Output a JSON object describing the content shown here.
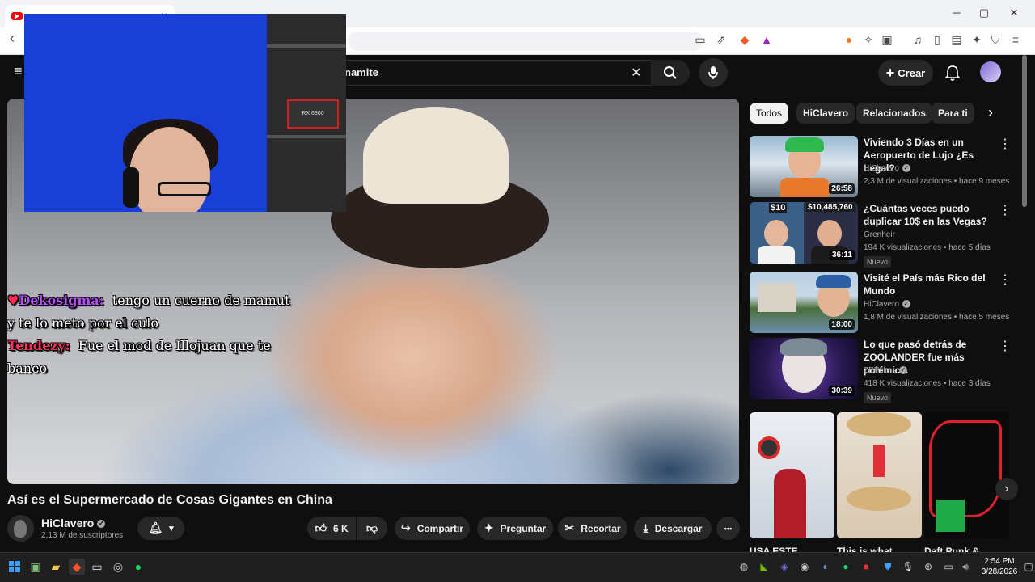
{
  "browser": {
    "tab_title": "",
    "tab_close": "✕",
    "window_controls": [
      "─",
      "▢",
      "✕"
    ],
    "icons": [
      "back-icon",
      "screenshot-icon",
      "share-icon",
      "brave-shield-icon",
      "brave-rewards-icon",
      "brave-leo-icon",
      "extensions-icon",
      "playlist-icon",
      "music-icon",
      "sidebar-icon",
      "wallet-icon",
      "vpn-icon",
      "menu-icon"
    ]
  },
  "header": {
    "search_value": "namite",
    "clear_symbol": "✕",
    "create_label": "Crear"
  },
  "video": {
    "chat": [
      {
        "user": "Dekosigma:",
        "message": "tengo un cuerno de mamut y te lo meto por el culo",
        "color": "#b84cff"
      },
      {
        "user": "Tendezy:",
        "message": "Fue el mod de Illojuan que te baneo",
        "color": "#ff3060"
      }
    ],
    "webcam_box_label": "RX 6800",
    "title": "Así es el Supermercado de Cosas Gigantes en China"
  },
  "channel": {
    "name": "HiClavero",
    "subscribers": "2,13 M de suscriptores"
  },
  "actions": {
    "likes": "6 K",
    "share": "Compartir",
    "ask": "Preguntar",
    "clip": "Recortar",
    "download": "Descargar",
    "more": "•••"
  },
  "sidebar": {
    "chips": [
      "Todos",
      "HiClavero",
      "Relacionados",
      "Para ti"
    ],
    "recommendations": [
      {
        "title": "Viviendo 3 Días en un Aeropuerto de Lujo ¿Es Legal?",
        "channel": "HiClavero",
        "verified": true,
        "meta": "2,3 M de visualizaciones • hace 9 meses",
        "duration": "26:58",
        "new": false
      },
      {
        "title": "¿Cuántas veces puedo duplicar 10$ en las Vegas?",
        "channel": "Grenheir",
        "verified": false,
        "meta": "194 K visualizaciones • hace 5 días",
        "duration": "36:11",
        "new": true,
        "thumb_labels": [
          "$10",
          "$10,485,760"
        ]
      },
      {
        "title": "Visité el País más Rico del Mundo",
        "channel": "HiClavero",
        "verified": true,
        "meta": "1,8 M de visualizaciones • hace 5 meses",
        "duration": "18:00",
        "new": false
      },
      {
        "title": "Lo que pasó detrás de ZOOLANDER fue más polémic...",
        "channel": "ZEPfilms",
        "verified": true,
        "meta": "418 K visualizaciones • hace 3 días",
        "duration": "30:39",
        "new": true
      }
    ],
    "new_label": "Nuevo",
    "shorts": [
      {
        "title": "USA ESTE"
      },
      {
        "title": "This is what"
      },
      {
        "title": "Daft Punk &"
      }
    ]
  },
  "taskbar": {
    "time": "2:54 PM",
    "date": "3/28/2026"
  },
  "colors": {
    "yt_bg": "#0f0f0f",
    "chip_active": "#f1f1f1",
    "accent_red": "#ff0000"
  }
}
